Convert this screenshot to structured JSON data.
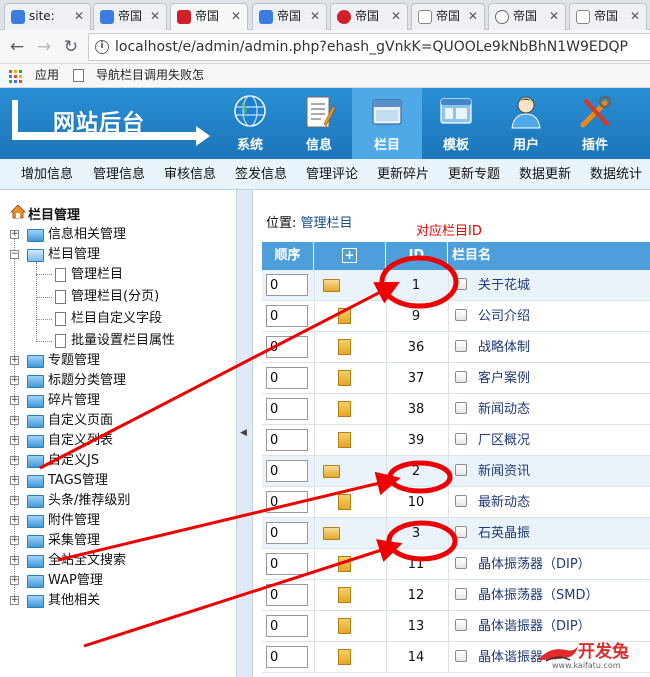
{
  "browser": {
    "tabs": [
      {
        "label": "site:",
        "color": "#3a7de0"
      },
      {
        "label": "帝国",
        "color": "#3a7de0"
      },
      {
        "label": "帝国",
        "color": "#d0202a"
      },
      {
        "label": "帝国",
        "color": "#3a7de0"
      },
      {
        "label": "帝国",
        "color": "#d0202a"
      },
      {
        "label": "帝国",
        "color": "#888888"
      },
      {
        "label": "帝国",
        "color": "#6a6a6a"
      },
      {
        "label": "帝国",
        "color": "#888888"
      }
    ],
    "url": "localhost/e/admin/admin.php?ehash_gVnkK=QUOOLe9kNbBhN1W9EDQP",
    "bookmarks": [
      "应用",
      "导航栏目调用失败怎"
    ]
  },
  "header": {
    "logo_text": "网站后台",
    "nav": [
      {
        "label": "系统",
        "icon": "globe-icon"
      },
      {
        "label": "信息",
        "icon": "notepad-icon"
      },
      {
        "label": "栏目",
        "icon": "window-icon"
      },
      {
        "label": "模板",
        "icon": "template-icon"
      },
      {
        "label": "用户",
        "icon": "user-icon"
      },
      {
        "label": "插件",
        "icon": "tools-icon"
      }
    ],
    "active_nav": "栏目"
  },
  "subnav": [
    "增加信息",
    "管理信息",
    "审核信息",
    "签发信息",
    "管理评论",
    "更新碎片",
    "更新专题",
    "数据更新",
    "数据统计"
  ],
  "tree": {
    "title": "栏目管理",
    "items": [
      "信息相关管理",
      "栏目管理",
      "专题管理",
      "标题分类管理",
      "碎片管理",
      "自定义页面",
      "自定义列表",
      "自定义JS",
      "TAGS管理",
      "头条/推荐级别",
      "附件管理",
      "采集管理",
      "全站全文搜索",
      "WAP管理",
      "其他相关"
    ],
    "children": [
      "管理栏目",
      "管理栏目(分页)",
      "栏目自定义字段",
      "批量设置栏目属性"
    ]
  },
  "main": {
    "position_label": "位置:",
    "position_link": "管理栏目",
    "annotation": "对应栏目ID",
    "columns": [
      "顺序",
      "+",
      "ID",
      "栏目名"
    ],
    "rows": [
      {
        "order": "0",
        "id": "1",
        "name": "关于花城"
      },
      {
        "order": "0",
        "id": "9",
        "name": "公司介绍"
      },
      {
        "order": "0",
        "id": "36",
        "name": "战略体制"
      },
      {
        "order": "0",
        "id": "37",
        "name": "客户案例"
      },
      {
        "order": "0",
        "id": "38",
        "name": "新闻动态"
      },
      {
        "order": "0",
        "id": "39",
        "name": "厂区概况"
      },
      {
        "order": "0",
        "id": "2",
        "name": "新闻资讯"
      },
      {
        "order": "0",
        "id": "10",
        "name": "最新动态"
      },
      {
        "order": "0",
        "id": "3",
        "name": "石英晶振"
      },
      {
        "order": "0",
        "id": "11",
        "name": "晶体振荡器（DIP）"
      },
      {
        "order": "0",
        "id": "12",
        "name": "晶体振荡器（SMD）"
      },
      {
        "order": "0",
        "id": "13",
        "name": "晶体谐振器（DIP）"
      },
      {
        "order": "0",
        "id": "14",
        "name": "晶体谐振器"
      }
    ]
  },
  "watermark": {
    "title": "开发兔",
    "url": "www.kaifatu.com"
  },
  "colors": {
    "header": "#1c75ba",
    "annotation": "#e00000",
    "table_header": "#4d9fdc"
  }
}
